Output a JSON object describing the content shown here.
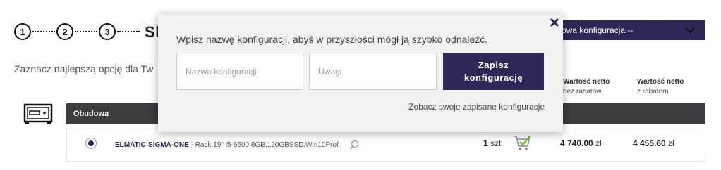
{
  "steps": [
    "1",
    "2",
    "3"
  ],
  "page_title": "Sk",
  "subtitle": "Zaznacz najlepszą opcję dla Tw",
  "config_select": {
    "value": "owa konfiguracja --"
  },
  "columns": {
    "net_value": {
      "title": "Wartość netto",
      "sub": "bez rabatów"
    },
    "net_value_discount": {
      "title": "Wartość netto",
      "sub": "z rabatem"
    }
  },
  "category": {
    "label": "Obudowa"
  },
  "product": {
    "name": "ELMATIC-SIGMA-ONE",
    "description": " - Rack 19\" i5-6500 8GB,120GBSSD,Win10Prof.",
    "qty": "1",
    "qty_unit": "szt",
    "price_net": "4 740.00",
    "price_net_discount": "4 455.60",
    "currency": "zł"
  },
  "modal": {
    "message": "Wpisz nazwę konfiguracji, abyś w przyszłości mógł ją szybko odnaleźć.",
    "name_placeholder": "Nazwa konfiguracji",
    "notes_placeholder": "Uwagi",
    "save_label": "Zapisz konfigurację",
    "saved_link": "Zobacz swoje zapisane konfiguracje"
  },
  "colors": {
    "accent": "#2e2757",
    "category_bar": "#3c3c40",
    "modal_bg": "#f2f2f2"
  },
  "icons": [
    "close-icon",
    "chevron-down-icon",
    "case-icon",
    "zoom-icon",
    "cart-icon"
  ]
}
